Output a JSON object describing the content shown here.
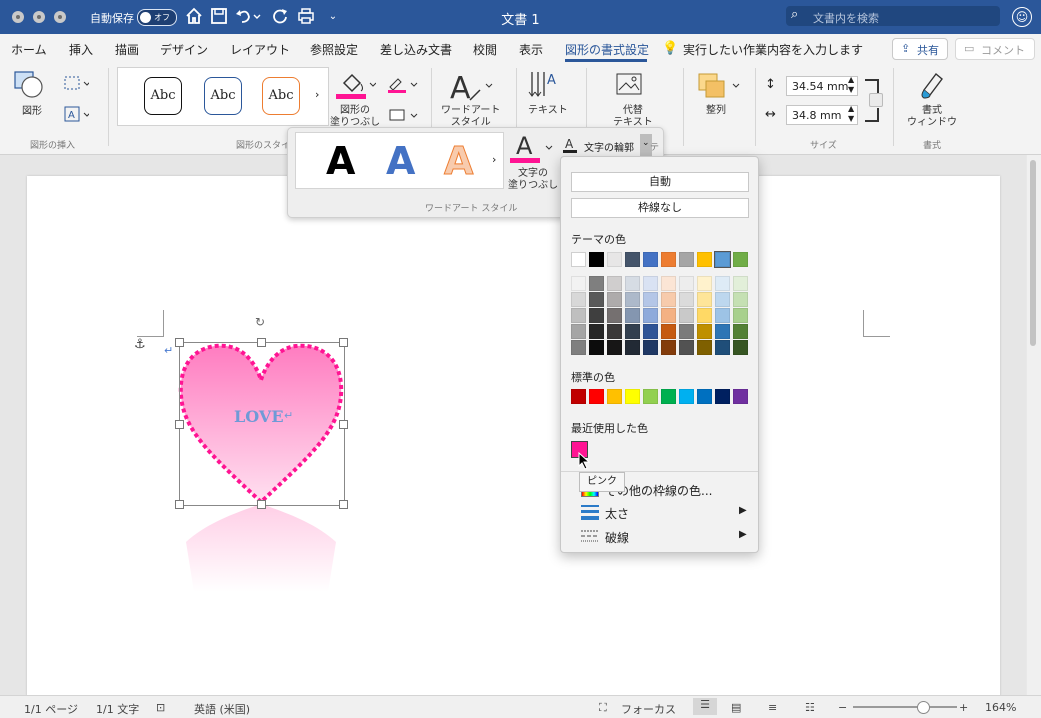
{
  "titlebar": {
    "autosave_label": "自動保存",
    "autosave_state": "オフ",
    "doc_title": "文書 1",
    "search_placeholder": "文書内を検索"
  },
  "tabs": [
    {
      "label": "ホーム"
    },
    {
      "label": "挿入"
    },
    {
      "label": "描画"
    },
    {
      "label": "デザイン"
    },
    {
      "label": "レイアウト"
    },
    {
      "label": "参照設定"
    },
    {
      "label": "差し込み文書"
    },
    {
      "label": "校閲"
    },
    {
      "label": "表示"
    },
    {
      "label": "図形の書式設定",
      "active": true
    }
  ],
  "tell_me": "実行したい作業内容を入力します",
  "share_label": "共有",
  "comment_label": "コメント",
  "ribbon": {
    "shapes_label": "図形",
    "insert_shapes_group": "図形の挿入",
    "shape_styles_group": "図形のスタイ",
    "gallery_abc": "Abc",
    "shape_fill_label": "図形の\n塗りつぶし",
    "wordart_label": "ワードアート\nスタイル",
    "text_label": "テキスト",
    "alt_text_label": "代替\nテキスト",
    "arrange_label": "整列",
    "size_group": "サイズ",
    "height_value": "34.54 mm",
    "width_value": "34.8 mm",
    "format_pane_label": "書式\nウィンドウ",
    "format_group": "書式"
  },
  "wordart_panel": {
    "letter": "A",
    "text_fill_label": "文字の\n塗りつぶし",
    "text_outline_label": "文字の輪郭",
    "group_label": "ワードアート スタイル",
    "hidden_tail": "ティ"
  },
  "shape": {
    "text": "LOVE"
  },
  "color_menu": {
    "auto_label": "自動",
    "no_outline_label": "枠線なし",
    "theme_colors_label": "テーマの色",
    "standard_colors_label": "標準の色",
    "recent_colors_label": "最近使用した色",
    "more_colors_label": "その他の枠線の色...",
    "weight_label": "太さ",
    "dashes_label": "破線",
    "tooltip": "ピンク",
    "theme_top": [
      "#ffffff",
      "#000000",
      "#e7e6e6",
      "#44546a",
      "#4472c4",
      "#ed7d31",
      "#a5a5a5",
      "#ffc000",
      "#5b9bd5",
      "#70ad47"
    ],
    "theme_shades": [
      [
        "#f2f2f2",
        "#7f7f7f",
        "#d0cece",
        "#d6dce4",
        "#d9e2f3",
        "#fbe5d5",
        "#ededed",
        "#fff2cc",
        "#deebf6",
        "#e2efd9"
      ],
      [
        "#d8d8d8",
        "#595959",
        "#aeabab",
        "#adb9ca",
        "#b4c6e7",
        "#f7cbac",
        "#dbdbdb",
        "#fee599",
        "#bdd7ee",
        "#c5e0b3"
      ],
      [
        "#bfbfbf",
        "#3f3f3f",
        "#757070",
        "#8496b0",
        "#8eaadb",
        "#f4b183",
        "#c9c9c9",
        "#ffd965",
        "#9dc3e6",
        "#a8d08d"
      ],
      [
        "#a5a5a5",
        "#262626",
        "#3a3838",
        "#323f4f",
        "#2f5496",
        "#c55a11",
        "#7b7b7b",
        "#bf9000",
        "#2e75b5",
        "#538135"
      ],
      [
        "#7f7f7f",
        "#0c0c0c",
        "#171616",
        "#222a35",
        "#1f3864",
        "#833c0b",
        "#525252",
        "#7f6000",
        "#1f4e79",
        "#375623"
      ]
    ],
    "standard": [
      "#c00000",
      "#ff0000",
      "#ffc000",
      "#ffff00",
      "#92d050",
      "#00b050",
      "#00b0f0",
      "#0070c0",
      "#002060",
      "#7030a0"
    ],
    "recent": [
      "#ff1493"
    ]
  },
  "statusbar": {
    "page": "1/1 ページ",
    "words": "1/1 文字",
    "language": "英語 (米国)",
    "focus": "フォーカス",
    "zoom": "164%",
    "zoom_level": 0.74
  },
  "colors": {
    "accent": "#2b579a",
    "pink": "#ff1493"
  }
}
